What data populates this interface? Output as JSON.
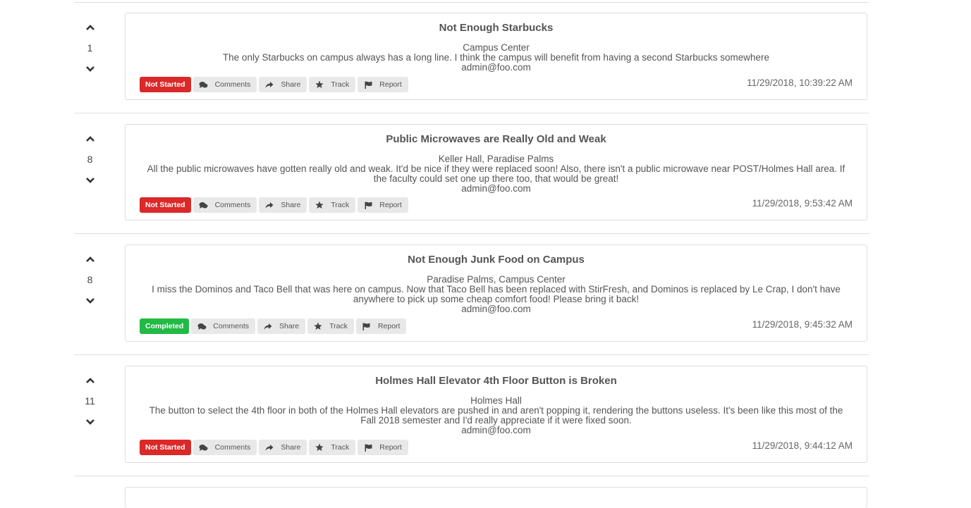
{
  "posts": [
    {
      "votes": "1",
      "title": "Not Enough Starbucks",
      "location": "Campus Center",
      "description": "The only Starbucks on campus always has a long line. I think the campus will benefit from having a second Starbucks somewhere",
      "author": "admin@foo.com",
      "status": "Not Started",
      "timestamp": "11/29/2018, 10:39:22 AM"
    },
    {
      "votes": "8",
      "title": "Public Microwaves are Really Old and Weak",
      "location": "Keller Hall, Paradise Palms",
      "description": "All the public microwaves have gotten really old and weak. It'd be nice if they were replaced soon! Also, there isn't a public microwave near POST/Holmes Hall area. If the faculty could set one up there too, that would be great!",
      "author": "admin@foo.com",
      "status": "Not Started",
      "timestamp": "11/29/2018, 9:53:42 AM"
    },
    {
      "votes": "8",
      "title": "Not Enough Junk Food on Campus",
      "location": "Paradise Palms, Campus Center",
      "description": "I miss the Dominos and Taco Bell that was here on campus. Now that Taco Bell has been replaced with StirFresh, and Dominos is replaced by Le Crap, I don't have anywhere to pick up some cheap comfort food! Please bring it back!",
      "author": "admin@foo.com",
      "status": "Completed",
      "timestamp": "11/29/2018, 9:45:32 AM"
    },
    {
      "votes": "11",
      "title": "Holmes Hall Elevator 4th Floor Button is Broken",
      "location": "Holmes Hall",
      "description": "The button to select the 4th floor in both of the Holmes Hall elevators are pushed in and aren't popping it, rendering the buttons useless. It's been like this most of the Fall 2018 semester and I'd really appreciate if it were fixed soon.",
      "author": "admin@foo.com",
      "status": "Not Started",
      "timestamp": "11/29/2018, 9:44:12 AM"
    }
  ],
  "actions": {
    "comments": "Comments",
    "share": "Share",
    "track": "Track",
    "report": "Report"
  },
  "icons": {
    "upvote": "chevron-up-icon",
    "downvote": "chevron-down-icon",
    "comments": "comments-icon",
    "share": "share-icon",
    "track": "star-icon",
    "report": "flag-icon"
  },
  "colors": {
    "not_started": "#db2828",
    "completed": "#21ba45"
  }
}
